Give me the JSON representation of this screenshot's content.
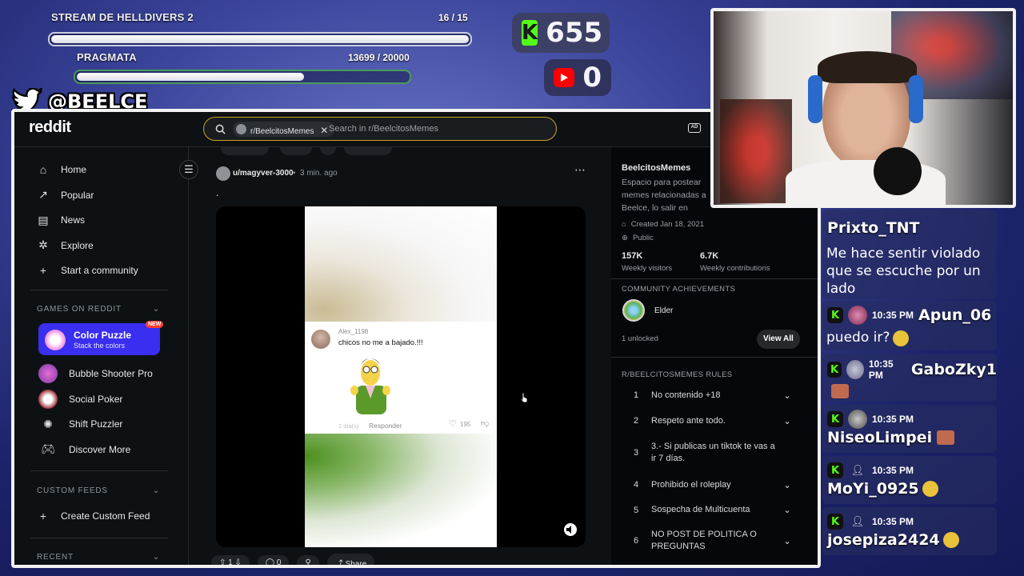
{
  "goals": [
    {
      "title": "STREAM DE HELLDIVERS 2",
      "count": "16 / 15",
      "progress": 1.0
    },
    {
      "title": "PRAGMATA",
      "count": "13699 / 20000",
      "progress": 0.685
    }
  ],
  "counters": {
    "kick": "655",
    "youtube": "0",
    "kick_color": "#53fc18",
    "youtube_color": "#ff0000"
  },
  "twitter_handle": "@BEELCE_",
  "reddit": {
    "logo": "reddit",
    "search_chip": "r/BeelcitosMemes",
    "search_placeholder": "Search in r/BeelcitosMemes",
    "nav": [
      {
        "label": "Home",
        "icon": "home-icon"
      },
      {
        "label": "Popular",
        "icon": "popular-icon"
      },
      {
        "label": "News",
        "icon": "news-icon"
      },
      {
        "label": "Explore",
        "icon": "explore-icon"
      },
      {
        "label": "Start a community",
        "icon": "plus-icon"
      }
    ],
    "games_title": "GAMES ON REDDIT",
    "featured_game": {
      "name": "Color Puzzle",
      "sub": "Stack the colors",
      "badge": "NEW"
    },
    "games": [
      "Bubble Shooter Pro",
      "Social Poker",
      "Shift Puzzler",
      "Discover More"
    ],
    "custom_feeds_title": "CUSTOM FEEDS",
    "create_feed": "Create Custom Feed",
    "recent_title": "RECENT",
    "post": {
      "author": "u/magyver-3000",
      "time": "3 min. ago",
      "body": ".",
      "upvotes": "1",
      "comments": "0",
      "share": "Share",
      "comment_user": "Alex_1198",
      "comment_text": "chicos no me a bajado.!!!",
      "comment_time": "1 día(s)",
      "comment_reply": "Responder",
      "comment_likes": "195"
    },
    "community": {
      "name": "BeelcitosMemes",
      "desc": "Espacio para postear memes relacionadas a Beelce, lo salir en Stream!",
      "created": "Created Jan 18, 2021",
      "visibility": "Public",
      "visitors": "157K",
      "visitors_label": "Weekly visitors",
      "contribs": "6.7K",
      "contribs_label": "Weekly contributions",
      "achievements_title": "COMMUNITY ACHIEVEMENTS",
      "achievement": "Elder",
      "unlocked": "1 unlocked",
      "view_all": "View All",
      "rules_title": "R/BEELCITOSMEMES RULES",
      "rules": [
        {
          "n": "1",
          "t": "No contenido +18"
        },
        {
          "n": "2",
          "t": "Respeto ante todo."
        },
        {
          "n": "3",
          "t": "3.- Si publicas un tiktok te vas a ir 7 días."
        },
        {
          "n": "4",
          "t": "Prohibido el roleplay"
        },
        {
          "n": "5",
          "t": "Sospecha de Multicuenta"
        },
        {
          "n": "6",
          "t": "NO POST DE POLITICA O PREGUNTAS"
        }
      ]
    }
  },
  "chat": {
    "partial_user": "Prixto_TNT",
    "partial_msg": "Me hace sentir violado que se escuche por un lado",
    "messages": [
      {
        "time": "10:35 PM",
        "user": "Apun_06",
        "msg": "puedo ir?"
      },
      {
        "time": "10:35 PM",
        "user": "GaboZky1",
        "msg": ""
      },
      {
        "time": "10:35 PM",
        "user": "NiseoLimpei",
        "msg": ""
      },
      {
        "time": "10:35 PM",
        "user": "MoYi_0925",
        "msg": ""
      },
      {
        "time": "10:35 PM",
        "user": "josepiza2424",
        "msg": ""
      }
    ]
  }
}
